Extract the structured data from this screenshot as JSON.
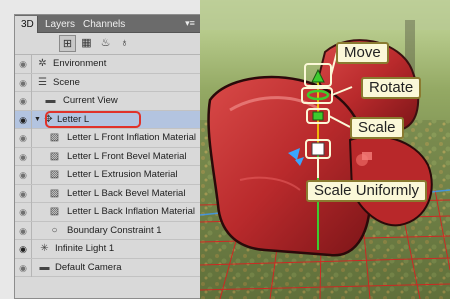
{
  "panel": {
    "tabs": [
      {
        "label": "3D",
        "active": true
      },
      {
        "label": "Layers",
        "active": false
      },
      {
        "label": "Channels",
        "active": false
      }
    ],
    "menu_icon": "panel-menu-icon",
    "toolbar_icons": [
      "scene-filter-icon",
      "meshes-filter-icon",
      "materials-filter-icon",
      "lights-filter-icon"
    ]
  },
  "scene_items": [
    {
      "label": "Environment",
      "icon": "environment-icon",
      "eye_visible": false
    },
    {
      "label": "Scene",
      "icon": "scene-icon",
      "eye_visible": false
    },
    {
      "label": "Current View",
      "icon": "camera-icon",
      "eye_visible": false
    },
    {
      "label": "Letter L",
      "icon": "mesh-icon",
      "eye_visible": true,
      "expanded": true,
      "selected": true
    },
    {
      "label": "Letter L Front Inflation Material",
      "icon": "material-icon",
      "eye_visible": false
    },
    {
      "label": "Letter L Front Bevel Material",
      "icon": "material-icon",
      "eye_visible": false
    },
    {
      "label": "Letter L Extrusion Material",
      "icon": "material-icon",
      "eye_visible": false
    },
    {
      "label": "Letter L Back Bevel Material",
      "icon": "material-icon",
      "eye_visible": false
    },
    {
      "label": "Letter L Back Inflation Material",
      "icon": "material-icon",
      "eye_visible": false
    },
    {
      "label": "Boundary Constraint 1",
      "icon": "constraint-icon",
      "eye_visible": false
    },
    {
      "label": "Infinite Light 1",
      "icon": "light-icon",
      "eye_visible": true
    },
    {
      "label": "Default Camera",
      "icon": "camera-icon",
      "eye_visible": false
    }
  ],
  "callouts": {
    "move": "Move",
    "rotate": "Rotate",
    "scale": "Scale",
    "scale_uniformly": "Scale Uniformly"
  },
  "colors": {
    "panel_bg": "#d9d9d9",
    "selection": "#b3c4e0",
    "highlight_ring": "#e0322a",
    "object_red": "#c0282c",
    "gizmo_green": "#3ecb2e",
    "gizmo_yellow": "#ffe600",
    "callout_bg": "#fbf8d8"
  }
}
